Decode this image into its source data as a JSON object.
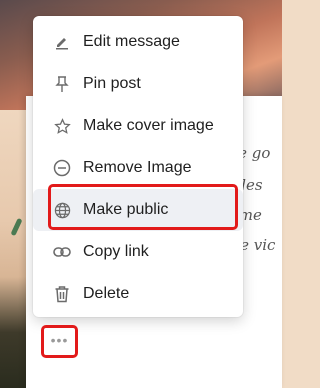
{
  "menu": {
    "items": [
      {
        "label": "Edit message",
        "icon": "pencil-icon"
      },
      {
        "label": "Pin post",
        "icon": "pin-icon"
      },
      {
        "label": "Make cover image",
        "icon": "star-icon"
      },
      {
        "label": "Remove Image",
        "icon": "minus-circle-icon"
      },
      {
        "label": "Make public",
        "icon": "globe-icon"
      },
      {
        "label": "Copy link",
        "icon": "link-icon"
      },
      {
        "label": "Delete",
        "icon": "trash-icon"
      }
    ],
    "highlighted_item": "Make public"
  },
  "post": {
    "text_fragments": [
      "are go",
      "u des",
      "some",
      "live vic"
    ],
    "more_button_label": "•••"
  },
  "colors": {
    "highlight": "#e21a1a",
    "menu_text": "#1f1f1f",
    "icon": "#6b6b6b"
  }
}
